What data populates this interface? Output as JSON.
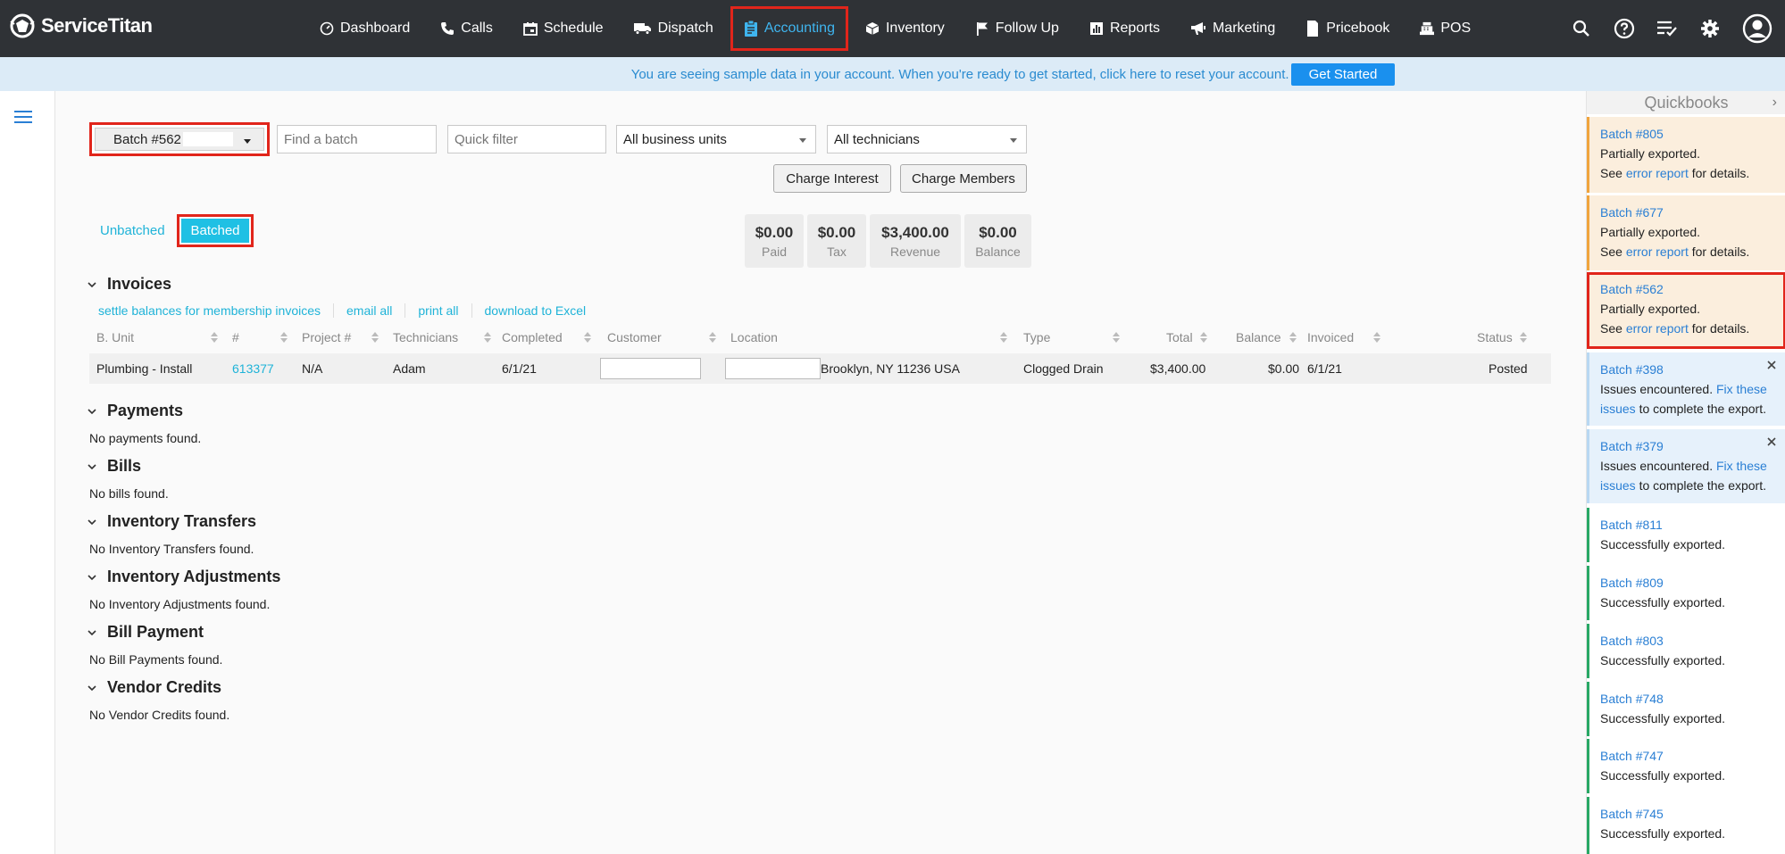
{
  "brand": {
    "name": "ServiceTitan"
  },
  "nav": {
    "items": [
      {
        "label": "Dashboard",
        "icon": "dashboard-icon"
      },
      {
        "label": "Calls",
        "icon": "phone-icon"
      },
      {
        "label": "Schedule",
        "icon": "calendar-icon"
      },
      {
        "label": "Dispatch",
        "icon": "truck-icon"
      },
      {
        "label": "Accounting",
        "icon": "clipboard-icon",
        "active": true
      },
      {
        "label": "Inventory",
        "icon": "box-icon"
      },
      {
        "label": "Follow Up",
        "icon": "flag-icon"
      },
      {
        "label": "Reports",
        "icon": "bar-chart-icon"
      },
      {
        "label": "Marketing",
        "icon": "megaphone-icon"
      },
      {
        "label": "Pricebook",
        "icon": "book-icon"
      },
      {
        "label": "POS",
        "icon": "register-icon"
      }
    ],
    "right_icons": [
      "search-icon",
      "help-icon",
      "tasks-icon",
      "gear-icon",
      "user-avatar-icon"
    ]
  },
  "banner": {
    "text": "You are seeing sample data in your account. When you're ready to get started, click here to reset your account.",
    "button": "Get Started"
  },
  "filters": {
    "batch_label": "Batch #562",
    "find_batch_placeholder": "Find a batch",
    "quick_filter_placeholder": "Quick filter",
    "business_units": "All business units",
    "technicians": "All technicians",
    "charge_interest": "Charge Interest",
    "charge_members": "Charge Members"
  },
  "toggle": {
    "unbatched": "Unbatched",
    "batched": "Batched"
  },
  "summary": [
    {
      "value": "$0.00",
      "label": "Paid"
    },
    {
      "value": "$0.00",
      "label": "Tax"
    },
    {
      "value": "$3,400.00",
      "label": "Revenue"
    },
    {
      "value": "$0.00",
      "label": "Balance"
    }
  ],
  "invoices": {
    "title": "Invoices",
    "links": [
      "settle balances for membership invoices",
      "email all",
      "print all",
      "download to Excel"
    ],
    "columns": [
      "B. Unit",
      "#",
      "Project #",
      "Technicians",
      "Completed",
      "Customer",
      "Location",
      "Type",
      "Total",
      "Balance",
      "Invoiced",
      "Status"
    ],
    "rows": [
      {
        "unit": "Plumbing - Install",
        "number": "613377",
        "project": "N/A",
        "tech": "Adam",
        "completed": "6/1/21",
        "location": "Brooklyn, NY 11236 USA",
        "type": "Clogged Drain",
        "total": "$3,400.00",
        "balance": "$0.00",
        "invoiced": "6/1/21",
        "status": "Posted"
      }
    ]
  },
  "sections": [
    {
      "title": "Payments",
      "empty": "No payments found."
    },
    {
      "title": "Bills",
      "empty": "No bills found."
    },
    {
      "title": "Inventory Transfers",
      "empty": "No Inventory Transfers found."
    },
    {
      "title": "Inventory Adjustments",
      "empty": "No Inventory Adjustments found."
    },
    {
      "title": "Bill Payment",
      "empty": "No Bill Payments found."
    },
    {
      "title": "Vendor Credits",
      "empty": "No Vendor Credits found."
    }
  ],
  "quickbooks": {
    "title": "Quickbooks",
    "partial": {
      "status": "Partially exported.",
      "see": "See",
      "link": "error report",
      "tail": "for details."
    },
    "issues": {
      "status": "Issues encountered.",
      "link": "Fix these issues",
      "tail": "to complete the export."
    },
    "ok_status": "Successfully exported.",
    "batches": [
      "Batch #805",
      "Batch #677",
      "Batch #562",
      "Batch #398",
      "Batch #379",
      "Batch #811",
      "Batch #809",
      "Batch #803",
      "Batch #748",
      "Batch #747",
      "Batch #745"
    ]
  }
}
